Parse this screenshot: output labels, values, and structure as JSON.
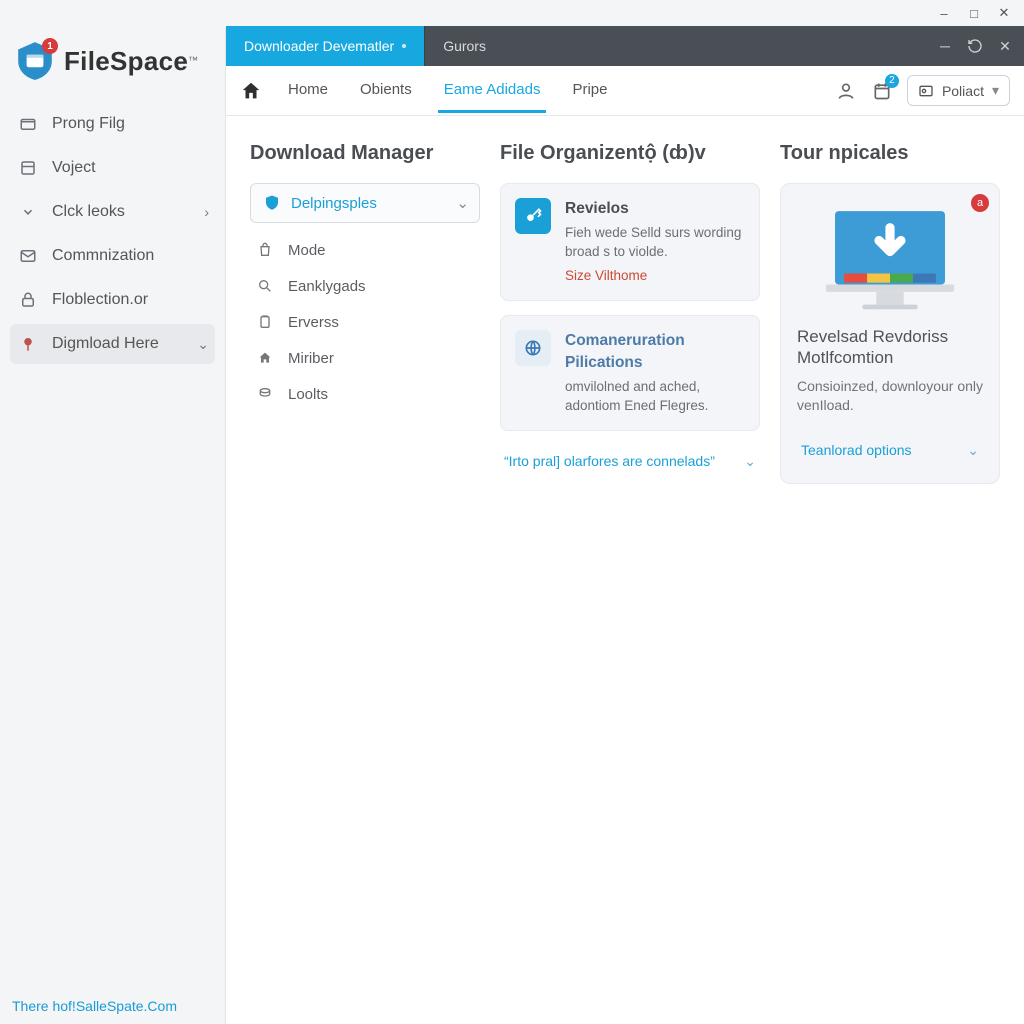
{
  "os": {
    "minimize": "–",
    "maximize": "□",
    "close": "✕"
  },
  "brand": {
    "name": "FileSpace",
    "tm": "™",
    "badge": "1"
  },
  "sidebar": {
    "items": [
      {
        "label": "Prong Filg"
      },
      {
        "label": "Voject"
      },
      {
        "label": "Clck leoks"
      },
      {
        "label": "Commnization"
      },
      {
        "label": "Floblection.or"
      },
      {
        "label": "Digmload Here"
      }
    ],
    "footer": "There hof!SalleSpate.Com"
  },
  "tabs": {
    "items": [
      {
        "label": "Downloader Devematler"
      },
      {
        "label": "Gurors"
      }
    ],
    "right_icons": [
      "minimize",
      "refresh",
      "close"
    ]
  },
  "navbar": {
    "links": [
      {
        "label": "Home"
      },
      {
        "label": "Obients"
      },
      {
        "label": "Eame Adidads"
      },
      {
        "label": "Pripe"
      }
    ],
    "calendar_badge": "2",
    "button": "Poliact"
  },
  "colA": {
    "title": "Download Manager",
    "pill": "Delpingsples",
    "sub": [
      {
        "label": "Mode"
      },
      {
        "label": "Eanklygads"
      },
      {
        "label": "Erverss"
      },
      {
        "label": "Miriber"
      },
      {
        "label": "Loolts"
      }
    ]
  },
  "colB": {
    "title": "File Organizentộ (ȸ)v",
    "cards": [
      {
        "title": "Revielos",
        "desc": "Fieh wede Selld surs wording broad s to violde.",
        "note": "Size Vilthome"
      },
      {
        "title": "Comaneruration Pilications",
        "desc": "omvilolned and ached, adontiom Ened Flegres."
      }
    ],
    "link": "“Irto pral] olarfores are connelads”"
  },
  "colC": {
    "title": "Tour npicales",
    "promo": {
      "badge": "a",
      "title": "Revelsad Revdoriss Motlfcomtion",
      "desc": "Consioinzed, downloyour only venIload.",
      "link": "Teanlorad options"
    }
  }
}
